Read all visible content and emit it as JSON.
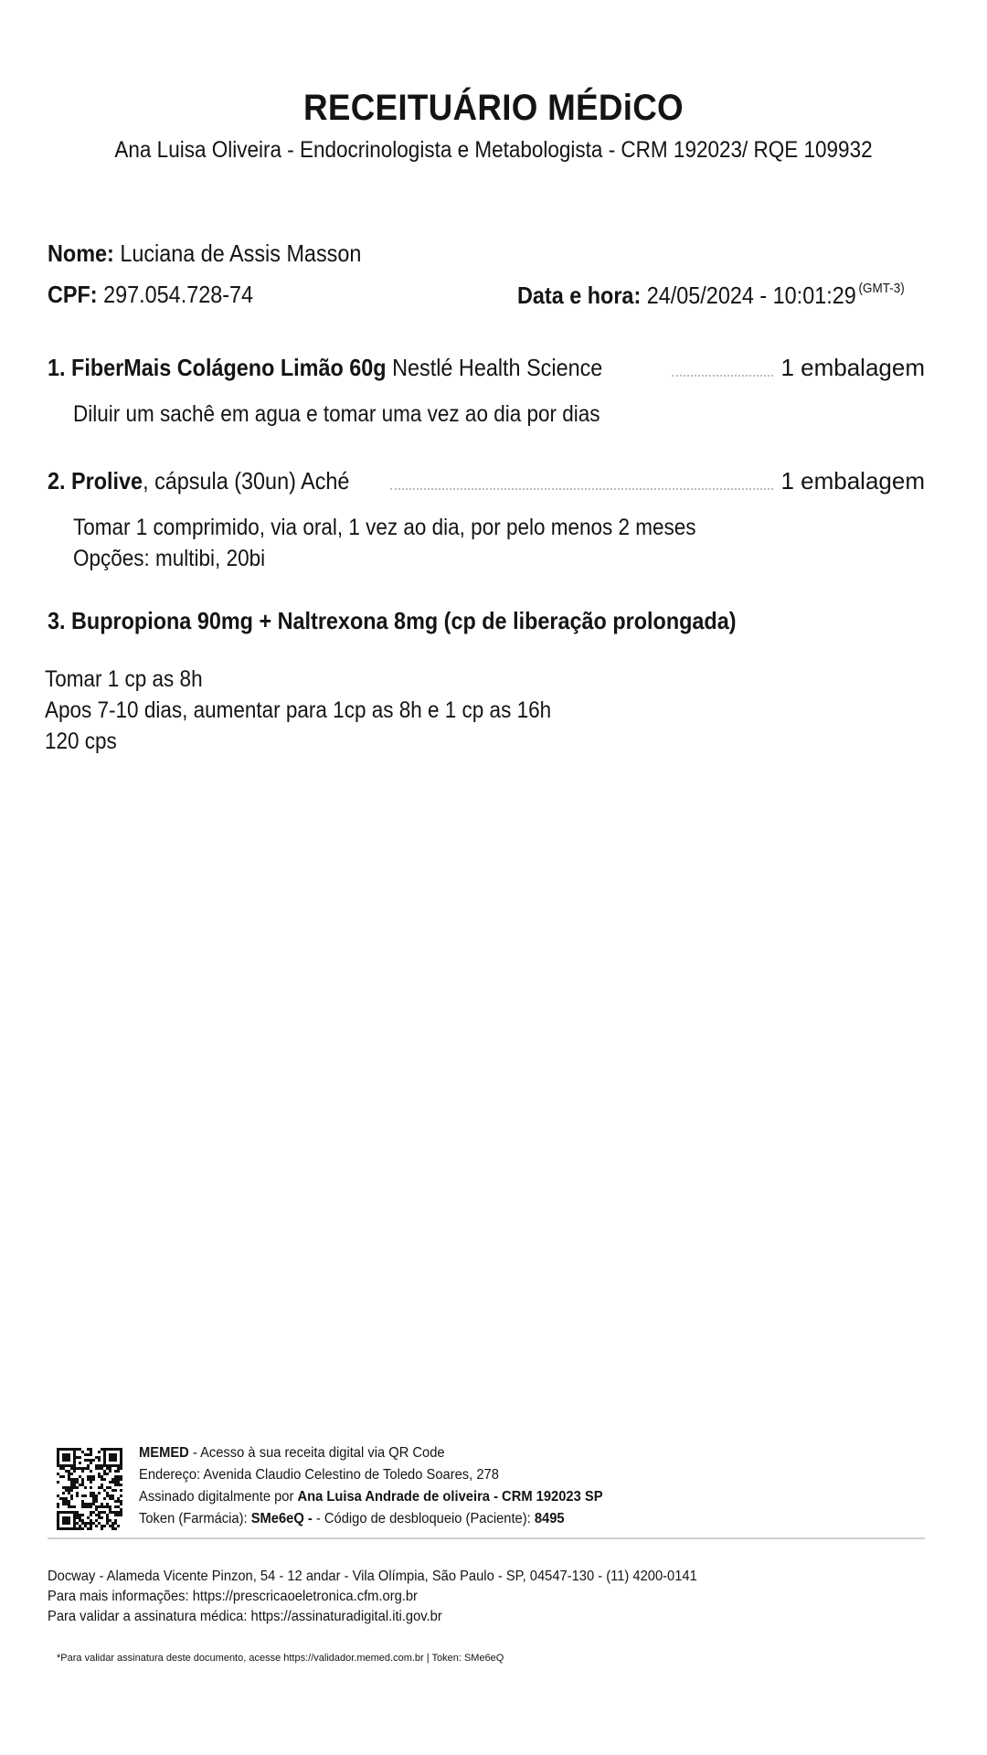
{
  "header": {
    "title": "RECEITUÁRIO MÉDiCO",
    "doctor_line": "Ana Luisa Oliveira  - Endocrinologista e Metabologista - CRM 192023/ RQE 109932"
  },
  "patient": {
    "name_label": "Nome:",
    "name_value": "Luciana de Assis Masson",
    "cpf_label": "CPF:",
    "cpf_value": "297.054.728-74",
    "datetime_label": "Data e hora:",
    "datetime_value": "24/05/2024 - 10:01:29",
    "timezone": "(GMT-3)"
  },
  "items": [
    {
      "number": "1.",
      "name_bold": "FiberMais Colágeno Limão 60g",
      "name_rest": " Nestlé Health Science",
      "quantity": "1 embalagem",
      "instructions": [
        "Diluir um sachê em agua e tomar uma vez ao dia por dias"
      ]
    },
    {
      "number": "2.",
      "name_bold": "Prolive",
      "name_rest": ", cápsula (30un) Aché",
      "quantity": "1 embalagem",
      "instructions": [
        "Tomar 1 comprimido, via oral, 1 vez ao dia, por pelo menos 2 meses",
        "Opções: multibi, 20bi"
      ]
    },
    {
      "number": "3.",
      "name_bold": "Bupropiona 90mg + Naltrexona 8mg (cp de liberação prolongada)",
      "instructions": [
        "Tomar 1 cp as 8h",
        "Apos 7-10 dias, aumentar para 1cp as 8h e 1 cp as 16h",
        "120 cps"
      ]
    }
  ],
  "footer": {
    "memed_brand": "MEMED",
    "memed_text": " - Acesso à sua receita digital via QR Code",
    "address_line": "Endereço: Avenida Claudio Celestino de Toledo Soares, 278",
    "signed_prefix": "Assinado digitalmente por ",
    "signed_name": "Ana Luisa Andrade de oliveira - CRM 192023 SP",
    "token_label": "Token (Farmácia): ",
    "token_value": "SMe6eQ",
    "unlock_label": " - Código de desbloqueio (Paciente): ",
    "unlock_value": "8495",
    "company_line": "Docway - Alameda Vicente Pinzon, 54 - 12  andar - Vila Olímpia, São Paulo - SP, 04547-130 - (11) 4200-0141",
    "info_line": "Para mais informações: https://prescricaoeletronica.cfm.org.br",
    "validate_line": "Para validar a assinatura médica: https://assinaturadigital.iti.gov.br",
    "validation_note": "*Para validar assinatura deste documento, acesse https://validador.memed.com.br | Token: SMe6eQ"
  },
  "icons": {
    "qr": "qr-code-icon"
  }
}
